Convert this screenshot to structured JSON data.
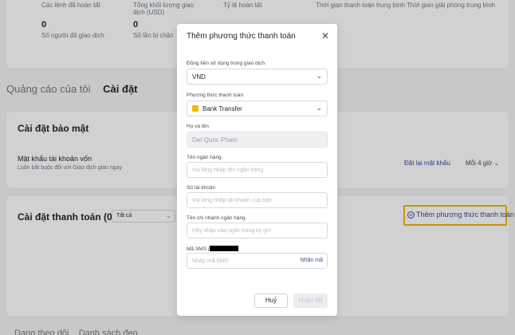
{
  "stats": {
    "completed_orders_label": "Các lệnh đã hoàn tất",
    "total_volume_label": "Tổng khối lượng giao dịch (USD)",
    "completion_rate_label": "Tỷ lệ hoàn tất",
    "avg_pay_time_label": "Thời gian thanh toán trung bình",
    "avg_release_time_label": "Thời gian giải phóng trung bình",
    "traders_value": "0",
    "traders_label": "Số người đã giao dịch",
    "blocked_value": "0",
    "blocked_label": "Số lần bị chặn"
  },
  "tabs": {
    "my_ads": "Quảng cáo của tôi",
    "settings": "Cài đặt"
  },
  "security": {
    "title": "Cài đặt bảo mật",
    "fund_password_title": "Mật khẩu tài khoản vốn",
    "fund_password_sub": "Luôn bắt buộc đối với Giao dịch giao ngay",
    "reset_link": "Đặt lại mật khẩu",
    "frequency": "Mỗi 4 giờ"
  },
  "payment_settings": {
    "title": "Cài đặt thanh toán (0)",
    "filter_value": "Tất cả",
    "add_button": "Thêm phương thức thanh toán"
  },
  "bottom_tabs": {
    "tab1": "Dang theo dõi",
    "tab2": "Danh sách đen"
  },
  "modal": {
    "title": "Thêm phương thức thanh toán",
    "currency_label": "Đồng tiền sử dụng trong giao dịch",
    "currency_value": "VND",
    "method_label": "Phương thức thanh toán",
    "method_value": "Bank Transfer",
    "name_label": "Họ và tên",
    "name_value": "Dat Quoc Pham",
    "bank_name_label": "Tên ngân hàng",
    "bank_name_placeholder": "Vui lòng nhập tên ngân hàng",
    "account_label": "Số tài khoản",
    "account_placeholder": "Vui lòng nhập tài khoản của bạn",
    "branch_label": "Tên chi nhánh ngân hàng",
    "branch_placeholder": "Hãy nhập vào ngân hàng kỳ gửi",
    "sms_label": "Mã SMS (",
    "sms_placeholder": "Nhập mã SMS",
    "sms_send": "Nhận mã",
    "cancel": "Huỷ",
    "confirm": "Hoàn tất"
  },
  "colors": {
    "accent": "#f0b90b",
    "link": "#3a4a9f"
  }
}
